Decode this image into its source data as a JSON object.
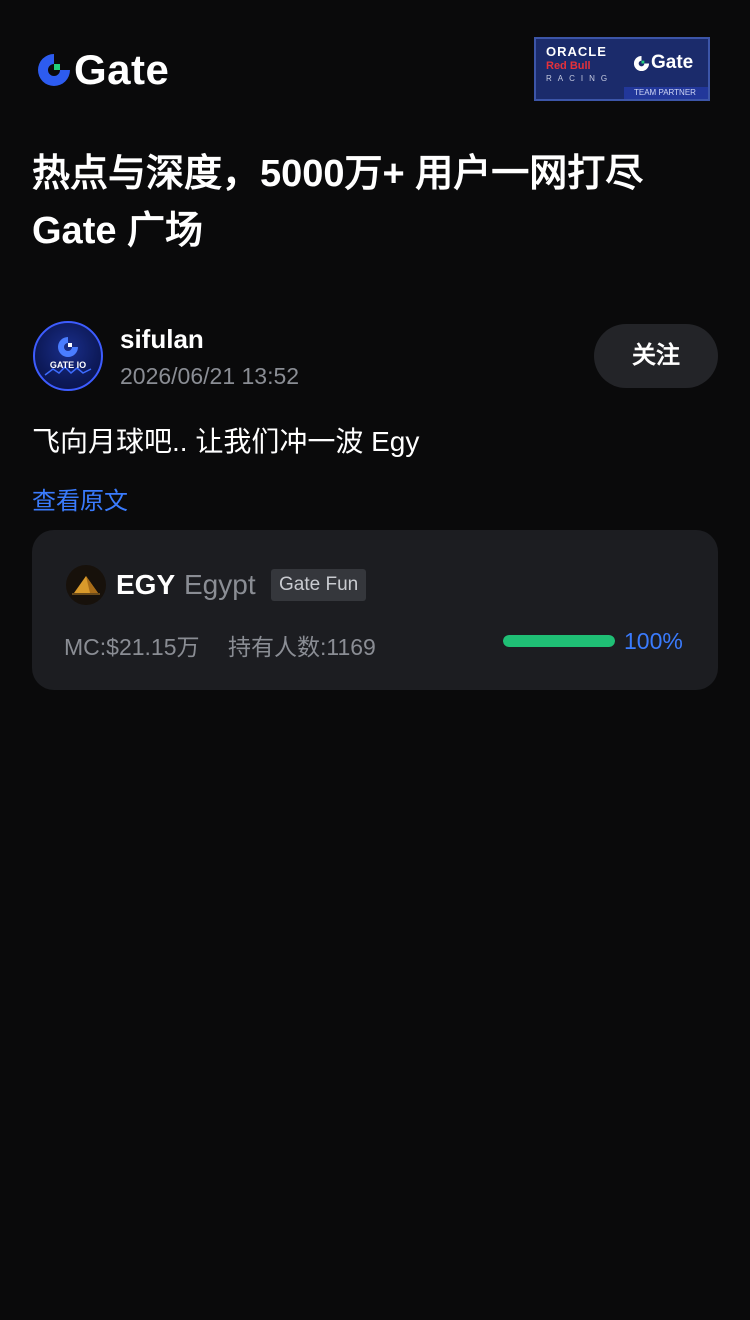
{
  "header": {
    "logo_text": "Gate",
    "partner": {
      "line1": "ORACLE",
      "line2": "Red Bull",
      "line3": "RACING",
      "brand": "Gate",
      "tag": "TEAM PARTNER"
    }
  },
  "hero": {
    "line1": "热点与深度，5000万+ 用户一网打尽",
    "line2": "Gate 广场"
  },
  "post": {
    "author": "sifulan",
    "avatar_label": "GATE IO",
    "timestamp": "2026/06/21 13:52",
    "follow_label": "关注",
    "content": "飞向月球吧.. 让我们冲一波 Egy",
    "view_original": "查看原文"
  },
  "token": {
    "symbol": "EGY",
    "name": "Egypt",
    "badge": "Gate Fun",
    "market_cap": "MC:$21.15万",
    "holders": "持有人数:1169",
    "progress_label": "100%",
    "progress": 1.0,
    "progress_color": "#1fbf75"
  },
  "colors": {
    "background": "#0a0a0b",
    "accent_blue": "#3a7bfd",
    "card": "#1c1d21"
  }
}
